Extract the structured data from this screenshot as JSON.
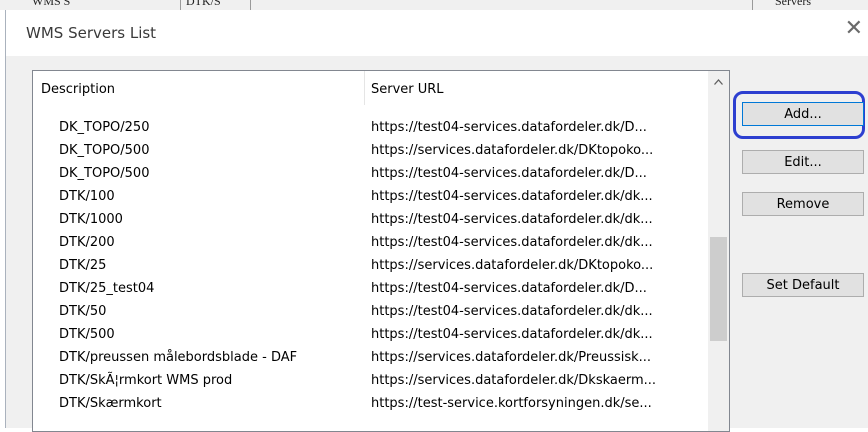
{
  "dialog": {
    "title": "WMS Servers List",
    "close_glyph": "✕"
  },
  "list": {
    "columns": [
      "Description",
      "Server URL"
    ],
    "rows": [
      {
        "description": "DK_TOPO/250",
        "url": "https://test04-services.datafordeler.dk/D..."
      },
      {
        "description": "DK_TOPO/500",
        "url": "https://services.datafordeler.dk/DKtopoko..."
      },
      {
        "description": "DK_TOPO/500",
        "url": "https://test04-services.datafordeler.dk/D..."
      },
      {
        "description": "DTK/100",
        "url": "https://test04-services.datafordeler.dk/dk..."
      },
      {
        "description": "DTK/1000",
        "url": "https://test04-services.datafordeler.dk/dk..."
      },
      {
        "description": "DTK/200",
        "url": "https://test04-services.datafordeler.dk/dk..."
      },
      {
        "description": "DTK/25",
        "url": "https://services.datafordeler.dk/DKtopoko..."
      },
      {
        "description": "DTK/25_test04",
        "url": "https://test04-services.datafordeler.dk/D..."
      },
      {
        "description": "DTK/50",
        "url": "https://test04-services.datafordeler.dk/dk..."
      },
      {
        "description": "DTK/500",
        "url": "https://test04-services.datafordeler.dk/dk..."
      },
      {
        "description": "DTK/preussen målebordsblade - DAF",
        "url": "https://services.datafordeler.dk/Preussisk..."
      },
      {
        "description": "DTK/SkÃ¦rmkort WMS prod",
        "url": "https://services.datafordeler.dk/Dkskaerm..."
      },
      {
        "description": "DTK/Skærmkort",
        "url": "https://test-service.kortforsyningen.dk/se..."
      }
    ]
  },
  "buttons": {
    "add": "Add...",
    "edit": "Edit...",
    "remove": "Remove",
    "set_default": "Set Default"
  },
  "background_window": {
    "texts": [
      "WMS S",
      "DTK/S",
      "Servers"
    ]
  },
  "colors": {
    "highlight_ring": "#2d3fd0",
    "default_button_border": "#0078d7"
  },
  "icons": {
    "close": "close-icon",
    "scroll_up": "chevron-up-icon"
  }
}
